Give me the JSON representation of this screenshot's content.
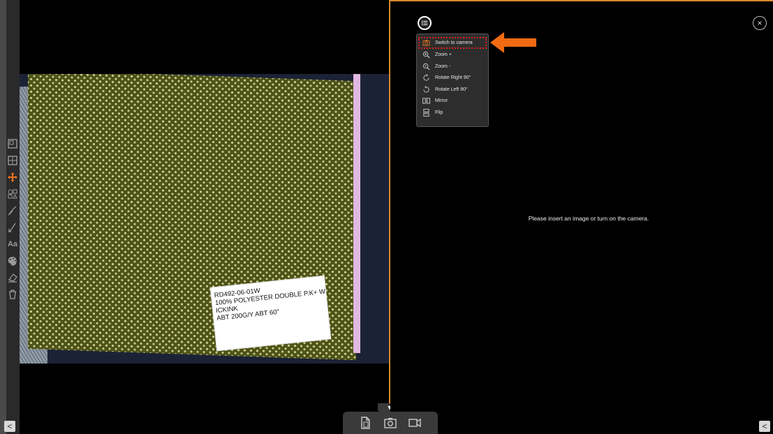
{
  "left_toolbar": {
    "tools": [
      {
        "icon": "square-icon",
        "active": false
      },
      {
        "icon": "grid-icon",
        "active": false
      },
      {
        "icon": "move-icon",
        "active": true
      },
      {
        "icon": "shapes-icon",
        "active": false
      },
      {
        "icon": "brush-icon",
        "active": false
      },
      {
        "icon": "pen-icon",
        "active": false
      },
      {
        "icon": "text-icon",
        "active": false,
        "label": "Aa"
      },
      {
        "icon": "palette-icon",
        "active": false
      },
      {
        "icon": "eraser-icon",
        "active": false
      },
      {
        "icon": "trash-icon",
        "active": false
      }
    ],
    "collapse_label": "<"
  },
  "photo_label_card": {
    "lines": [
      "RD492-06-01W",
      "100% POLYESTER DOUBLE P.K+   W",
      "ICKINK",
      "ABT 200G/Y      ABT  60\""
    ]
  },
  "right_pane": {
    "empty_message": "Please insert an image or turn on the camera.",
    "close_label": "×",
    "collapse_label": "<"
  },
  "menu": {
    "items": [
      {
        "label": "Switch to camera",
        "icon": "camera-icon",
        "highlighted": true
      },
      {
        "label": "Zoom +",
        "icon": "zoom-in-icon"
      },
      {
        "label": "Zoom -",
        "icon": "zoom-out-icon"
      },
      {
        "label": "Rotate Right 90°",
        "icon": "rotate-right-icon"
      },
      {
        "label": "Rotate Left 90°",
        "icon": "rotate-left-icon"
      },
      {
        "label": "Mirror",
        "icon": "mirror-icon"
      },
      {
        "label": "Flip",
        "icon": "flip-icon"
      }
    ]
  },
  "divider_tab_label": "▼",
  "bottom_bar": {
    "buttons": [
      "file-import-icon",
      "camera-icon",
      "video-icon"
    ]
  },
  "colors": {
    "accent": "#e8731e",
    "highlight_border": "#e02020",
    "divider": "#d9892f"
  }
}
